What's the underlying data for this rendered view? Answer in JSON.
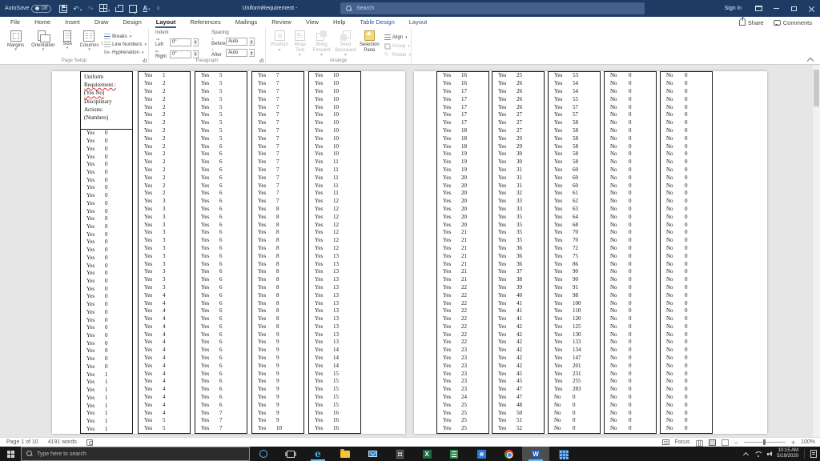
{
  "titlebar": {
    "autosave_label": "AutoSave",
    "autosave_state": "Off",
    "title": "UniformRequirement",
    "title_suffix": "-",
    "search_placeholder": "Search",
    "sign_in": "Sign in"
  },
  "menubar": {
    "tabs": [
      {
        "label": "File"
      },
      {
        "label": "Home"
      },
      {
        "label": "Insert"
      },
      {
        "label": "Draw"
      },
      {
        "label": "Design"
      },
      {
        "label": "Layout",
        "active": true
      },
      {
        "label": "References"
      },
      {
        "label": "Mailings"
      },
      {
        "label": "Review"
      },
      {
        "label": "View"
      },
      {
        "label": "Help"
      },
      {
        "label": "Table Design",
        "contextual": true
      },
      {
        "label": "Layout",
        "contextual": true
      }
    ],
    "share_label": "Share",
    "comments_label": "Comments"
  },
  "ribbon": {
    "page_setup": {
      "group_label": "Page Setup",
      "buttons": [
        "Margins",
        "Orientation",
        "Size",
        "Columns"
      ],
      "small": [
        "Breaks",
        "Line Numbers",
        "Hyphenation"
      ]
    },
    "paragraph": {
      "group_label": "Paragraph",
      "indent_label": "Indent",
      "spacing_label": "Spacing",
      "left_label": "Left",
      "right_label": "Right",
      "before_label": "Before",
      "after_label": "After",
      "left_value": "0\"",
      "right_value": "0\"",
      "before_value": "Auto",
      "after_value": "Auto"
    },
    "arrange": {
      "group_label": "Arrange",
      "items": [
        "Position",
        "Wrap Text",
        "Bring Forward",
        "Send Backward",
        "Selection Pane"
      ],
      "right_items": [
        "Align",
        "Group",
        "Rotate"
      ]
    }
  },
  "document": {
    "header_lines": [
      "Uniform",
      "Requirement :",
      "(Yes No)",
      "",
      "Disciplinary",
      "Actions:",
      "(Numbers)"
    ],
    "misspelled_lines": [
      1,
      2
    ],
    "columns": [
      {
        "page": 1,
        "header": true,
        "runs": [
          [
            "Yes",
            0,
            31
          ],
          [
            "Yes",
            1,
            8
          ]
        ]
      },
      {
        "page": 1,
        "runs": [
          [
            "Yes",
            1,
            1
          ],
          [
            "Yes",
            2,
            15
          ],
          [
            "Yes",
            3,
            12
          ],
          [
            "Yes",
            4,
            16
          ],
          [
            "Yes",
            5,
            2
          ]
        ]
      },
      {
        "page": 1,
        "runs": [
          [
            "Yes",
            5,
            9
          ],
          [
            "Yes",
            6,
            34
          ],
          [
            "Yes",
            7,
            3
          ]
        ]
      },
      {
        "page": 1,
        "runs": [
          [
            "Yes",
            7,
            17
          ],
          [
            "Yes",
            8,
            16
          ],
          [
            "Yes",
            9,
            12
          ],
          [
            "Yes",
            10,
            1
          ]
        ]
      },
      {
        "page": 1,
        "runs": [
          [
            "Yes",
            10,
            11
          ],
          [
            "Yes",
            11,
            5
          ],
          [
            "Yes",
            12,
            7
          ],
          [
            "Yes",
            13,
            12
          ],
          [
            "Yes",
            14,
            3
          ],
          [
            "Yes",
            15,
            5
          ],
          [
            "Yes",
            16,
            3
          ]
        ]
      },
      {
        "page": 2,
        "runs": [
          [
            "Yes",
            16,
            2
          ],
          [
            "Yes",
            17,
            5
          ],
          [
            "Yes",
            18,
            3
          ],
          [
            "Yes",
            19,
            3
          ],
          [
            "Yes",
            20,
            7
          ],
          [
            "Yes",
            21,
            7
          ],
          [
            "Yes",
            22,
            8
          ],
          [
            "Yes",
            23,
            6
          ],
          [
            "Yes",
            24,
            1
          ],
          [
            "Yes",
            25,
            4
          ]
        ]
      },
      {
        "page": 2,
        "runs": [
          [
            "Yes",
            25,
            1
          ],
          [
            "Yes",
            26,
            4
          ],
          [
            "Yes",
            27,
            3
          ],
          [
            "Yes",
            29,
            2
          ],
          [
            "Yes",
            30,
            2
          ],
          [
            "Yes",
            31,
            3
          ],
          [
            "Yes",
            32,
            1
          ],
          [
            "Yes",
            33,
            2
          ],
          [
            "Yes",
            35,
            4
          ],
          [
            "Yes",
            36,
            3
          ],
          [
            "Yes",
            37,
            1
          ],
          [
            "Yes",
            38,
            1
          ],
          [
            "Yes",
            39,
            1
          ],
          [
            "Yes",
            40,
            1
          ],
          [
            "Yes",
            41,
            3
          ],
          [
            "Yes",
            42,
            6
          ],
          [
            "Yes",
            45,
            2
          ],
          [
            "Yes",
            47,
            2
          ],
          [
            "Yes",
            48,
            1
          ],
          [
            "Yes",
            50,
            1
          ],
          [
            "Yes",
            51,
            1
          ],
          [
            "Yes",
            52,
            1
          ]
        ]
      },
      {
        "page": 2,
        "runs": [
          [
            "Yes",
            53,
            1
          ],
          [
            "Yes",
            54,
            2
          ],
          [
            "Yes",
            55,
            1
          ],
          [
            "Yes",
            57,
            2
          ],
          [
            "Yes",
            58,
            6
          ],
          [
            "Yes",
            60,
            3
          ],
          [
            "Yes",
            61,
            1
          ],
          [
            "Yes",
            62,
            1
          ],
          [
            "Yes",
            63,
            1
          ],
          [
            "Yes",
            64,
            1
          ],
          [
            "Yes",
            68,
            1
          ],
          [
            "Yes",
            70,
            2
          ],
          [
            "Yes",
            72,
            1
          ],
          [
            "Yes",
            75,
            1
          ],
          [
            "Yes",
            86,
            1
          ],
          [
            "Yes",
            90,
            2
          ],
          [
            "Yes",
            91,
            1
          ],
          [
            "Yes",
            98,
            1
          ],
          [
            "Yes",
            100,
            1
          ],
          [
            "Yes",
            110,
            1
          ],
          [
            "Yes",
            120,
            1
          ],
          [
            "Yes",
            125,
            1
          ],
          [
            "Yes",
            130,
            1
          ],
          [
            "Yes",
            133,
            1
          ],
          [
            "Yes",
            134,
            1
          ],
          [
            "Yes",
            147,
            1
          ],
          [
            "Yes",
            201,
            1
          ],
          [
            "Yes",
            231,
            1
          ],
          [
            "Yes",
            255,
            1
          ],
          [
            "Yes",
            283,
            1
          ],
          [
            "No",
            0,
            5
          ]
        ]
      },
      {
        "page": 2,
        "runs": [
          [
            "No",
            0,
            46
          ]
        ]
      },
      {
        "page": 2,
        "runs": [
          [
            "No",
            0,
            46
          ]
        ]
      }
    ]
  },
  "statusbar": {
    "page_info": "Page 1 of 10",
    "word_count": "4191 words",
    "focus_label": "Focus",
    "zoom_level": "100%"
  },
  "taskbar": {
    "search_placeholder": "Type here to search",
    "time": "10:15 AM",
    "date": "5/19/2020"
  }
}
